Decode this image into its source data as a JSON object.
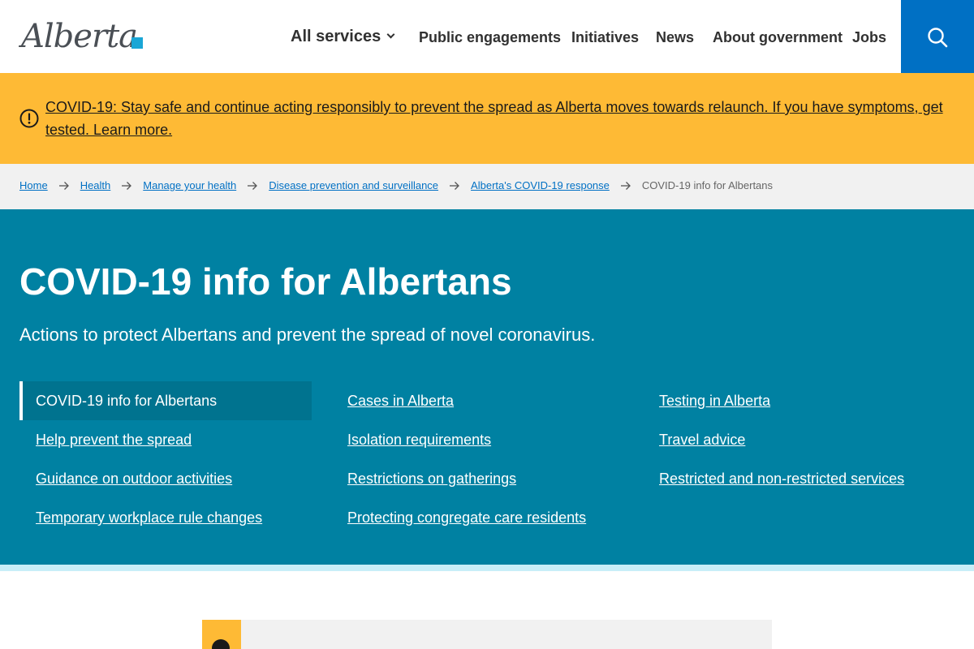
{
  "header": {
    "logo_text": "Alberta",
    "nav": [
      {
        "label": "All services"
      },
      {
        "label": "Public engagements"
      },
      {
        "label": "Initiatives"
      },
      {
        "label": "News"
      },
      {
        "label": "About government"
      },
      {
        "label": "Jobs"
      }
    ],
    "search_icon": "search-icon",
    "colors": {
      "search_bg": "#0070c4"
    }
  },
  "alert": {
    "icon": "alert-circle-icon",
    "text": "COVID-19: Stay safe and continue acting responsibly to prevent the spread as Alberta moves towards relaunch. If you have symptoms, get tested. Learn more.",
    "colors": {
      "bg": "#feba35"
    }
  },
  "breadcrumb": {
    "items": [
      {
        "label": "Home"
      },
      {
        "label": "Health"
      },
      {
        "label": "Manage your health"
      },
      {
        "label": "Disease prevention and surveillance"
      },
      {
        "label": "Alberta's COVID-19 response"
      }
    ],
    "current": "COVID-19 info for Albertans"
  },
  "hero": {
    "title": "COVID-19 info for Albertans",
    "subtitle": "Actions to protect Albertans and prevent the spread of novel coronavirus.",
    "links": [
      {
        "label": "COVID-19 info for Albertans",
        "active": true
      },
      {
        "label": "Help prevent the spread"
      },
      {
        "label": "Guidance on outdoor activities"
      },
      {
        "label": "Temporary workplace rule changes"
      },
      {
        "label": "Cases in Alberta"
      },
      {
        "label": "Isolation requirements"
      },
      {
        "label": "Restrictions on gatherings"
      },
      {
        "label": "Protecting congregate care residents"
      },
      {
        "label": "Testing in Alberta"
      },
      {
        "label": "Travel advice"
      },
      {
        "label": "Restricted and non-restricted services"
      }
    ],
    "colors": {
      "bg": "#0081a2",
      "active_bg": "#00738f",
      "bottom_band": "#c8eef8"
    }
  },
  "card": {
    "title": "",
    "colors": {
      "accent": "#feba35",
      "bg": "#f1f1f1"
    }
  }
}
